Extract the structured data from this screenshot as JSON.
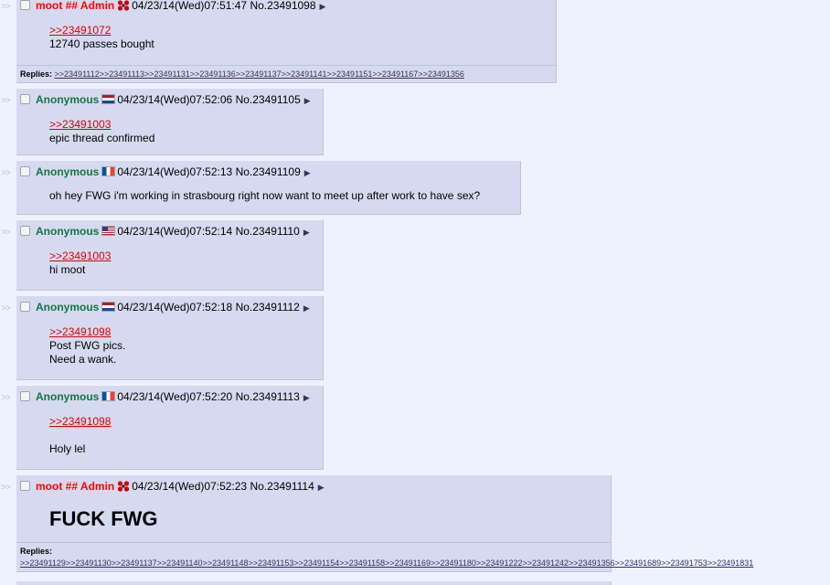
{
  "side_arrows": ">>",
  "posts": [
    {
      "name": "moot ## Admin",
      "datetime": "04/23/14(Wed)07:51:47",
      "number": "No.23491098",
      "quote": ">>23491072",
      "lines": [
        "12740 passes bought"
      ],
      "replies_label": "Replies:",
      "replies": [
        ">>23491112",
        ">>23491113",
        ">>23491131",
        ">>23491136",
        ">>23491137",
        ">>23491141",
        ">>23491151",
        ">>23491167",
        ">>23491356"
      ]
    },
    {
      "name": "Anonymous",
      "flag": "netherlands-flag-icon",
      "datetime": "04/23/14(Wed)07:52:06",
      "number": "No.23491105",
      "quote": ">>23491003",
      "lines": [
        "epic thread confirmed"
      ]
    },
    {
      "name": "Anonymous",
      "flag": "france-flag-icon",
      "datetime": "04/23/14(Wed)07:52:13",
      "number": "No.23491109",
      "lines": [
        "oh hey FWG i'm working in strasbourg right now want to meet up after work to have sex?"
      ]
    },
    {
      "name": "Anonymous",
      "flag": "usa-flag-icon",
      "datetime": "04/23/14(Wed)07:52:14",
      "number": "No.23491110",
      "quote": ">>23491003",
      "lines": [
        "hi moot"
      ]
    },
    {
      "name": "Anonymous",
      "flag": "netherlands-flag-icon",
      "datetime": "04/23/14(Wed)07:52:18",
      "number": "No.23491112",
      "quote": ">>23491098",
      "lines": [
        "Post FWG pics.",
        "Need a wank."
      ]
    },
    {
      "name": "Anonymous",
      "flag": "france-flag-icon",
      "datetime": "04/23/14(Wed)07:52:20",
      "number": "No.23491113",
      "quote": ">>23491098",
      "lines": [
        "",
        "Holy lel"
      ]
    },
    {
      "name": "moot ## Admin",
      "datetime": "04/23/14(Wed)07:52:23",
      "number": "No.23491114",
      "big_text": "FUCK FWG",
      "replies_label": "Replies:",
      "replies": [
        ">>23491129",
        ">>23491130",
        ">>23491137",
        ">>23491140",
        ">>23491148",
        ">>23491153",
        ">>23491154",
        ">>23491158",
        ">>23491169",
        ">>23491180",
        ">>23491222",
        ">>23491242",
        ">>23491356",
        ">>23491689",
        ">>23491753",
        ">>23491831"
      ]
    }
  ],
  "colors": {
    "background": "#eef2ff",
    "post_background": "#d6daf0",
    "border": "#b7c5d9",
    "anon_name": "#117743",
    "admin_name": "#ff0000",
    "quote_link": "#dd0000",
    "reply_link": "#34345c"
  }
}
